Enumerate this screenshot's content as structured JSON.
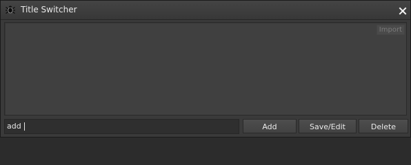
{
  "window": {
    "title": "Title Switcher",
    "app_icon": "spider-icon",
    "close_icon": "close-icon"
  },
  "list_panel": {
    "import_label": "Import",
    "items": []
  },
  "input": {
    "value": "add "
  },
  "buttons": {
    "add_label": "Add",
    "save_edit_label": "Save/Edit",
    "delete_label": "Delete"
  },
  "colors": {
    "window_bg": "#3a3a3a",
    "panel_bg": "#404040",
    "input_bg": "#2f2f2f",
    "text": "#e8e8e8",
    "muted_text": "#7a7a7a"
  }
}
